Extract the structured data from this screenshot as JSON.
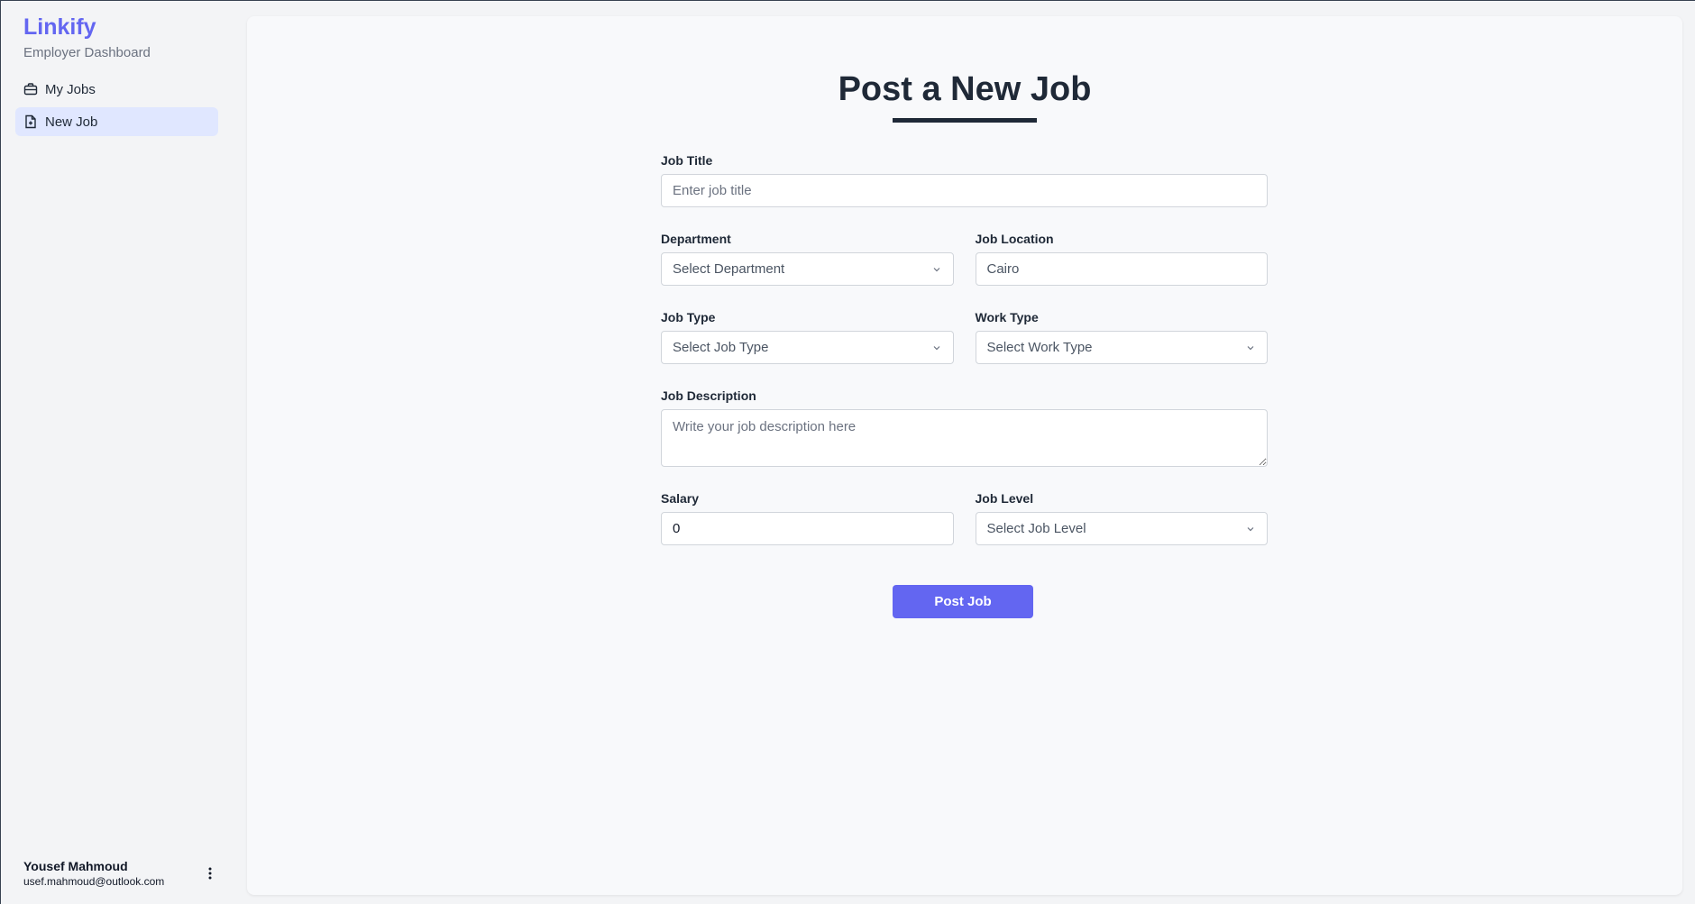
{
  "sidebar": {
    "brand": "Linkify",
    "subtitle": "Employer Dashboard",
    "items": [
      {
        "label": "My Jobs",
        "icon": "briefcase-icon"
      },
      {
        "label": "New Job",
        "icon": "file-plus-icon",
        "active": true
      }
    ],
    "user": {
      "name": "Yousef Mahmoud",
      "email": "usef.mahmoud@outlook.com"
    }
  },
  "main": {
    "title": "Post a New Job",
    "fields": {
      "job_title": {
        "label": "Job Title",
        "placeholder": "Enter job title",
        "value": ""
      },
      "department": {
        "label": "Department",
        "value": "Select Department"
      },
      "job_location": {
        "label": "Job Location",
        "value": "Cairo"
      },
      "job_type": {
        "label": "Job Type",
        "value": "Select Job Type"
      },
      "work_type": {
        "label": "Work Type",
        "value": "Select Work Type"
      },
      "job_description": {
        "label": "Job Description",
        "placeholder": "Write your job description here"
      },
      "salary": {
        "label": "Salary",
        "value": "0"
      },
      "job_level": {
        "label": "Job Level",
        "value": "Select Job Level"
      }
    },
    "submit_label": "Post Job"
  },
  "colors": {
    "accent": "#6366f1",
    "active_nav_bg": "#e0e7ff",
    "text_dark": "#1f2937"
  }
}
